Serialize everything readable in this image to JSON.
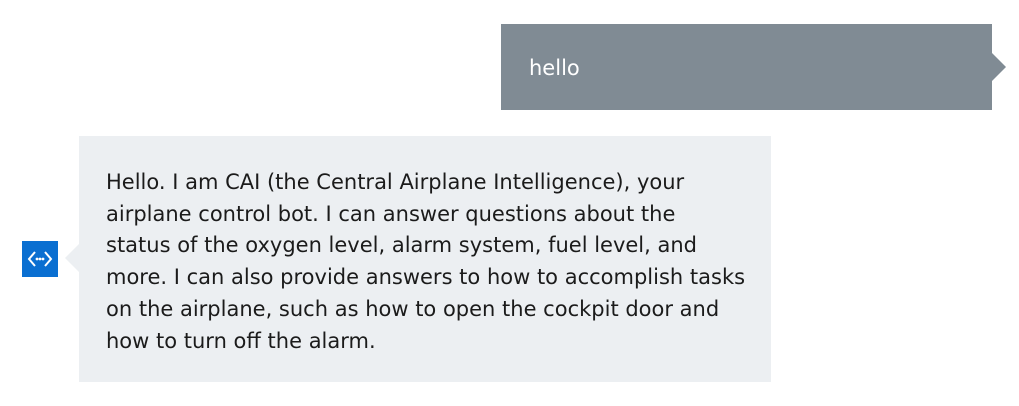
{
  "colors": {
    "user_bubble": "#808b94",
    "bot_bubble": "#eceff2",
    "bot_avatar": "#0a6fd1",
    "user_text": "#ffffff",
    "bot_text": "#1b1b1b"
  },
  "messages": {
    "user": {
      "text": "hello"
    },
    "bot": {
      "avatar_icon": "code-brackets-icon",
      "lines": [
        "Hello. I am CAI (the Central Airplane Intelligence), your",
        "airplane control bot. I can answer questions about the",
        "status of the oxygen level, alarm system, fuel level, and",
        "more. I can also provide answers to how to accomplish tasks",
        "on the airplane, such as how to open the cockpit door and",
        "how to turn off the alarm."
      ]
    }
  }
}
